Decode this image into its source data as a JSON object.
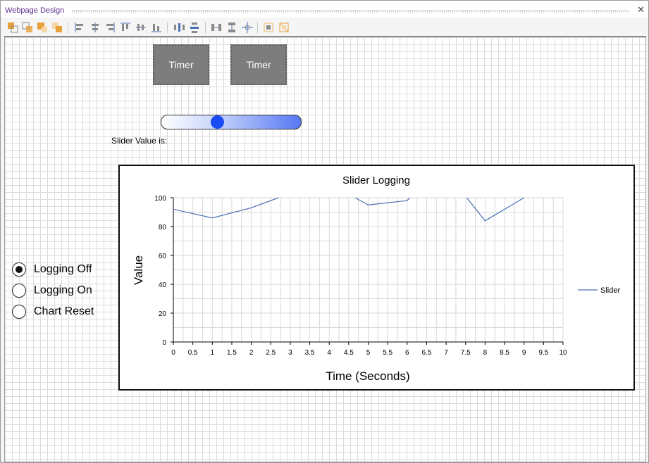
{
  "window": {
    "title": "Webpage Design",
    "close_glyph": "✕"
  },
  "toolbar": {
    "buttons": [
      {
        "icon": "bring-to-front-icon"
      },
      {
        "icon": "send-backward-icon"
      },
      {
        "icon": "bring-forward-icon"
      },
      {
        "icon": "send-to-back-icon"
      },
      {
        "icon": "align-left-icon"
      },
      {
        "icon": "align-center-icon"
      },
      {
        "icon": "align-right-icon"
      },
      {
        "icon": "align-top-icon"
      },
      {
        "icon": "align-middle-icon"
      },
      {
        "icon": "align-bottom-icon"
      },
      {
        "icon": "distribute-horizontal-icon"
      },
      {
        "icon": "distribute-vertical-icon"
      },
      {
        "icon": "space-horizontal-icon"
      },
      {
        "icon": "space-vertical-icon"
      },
      {
        "icon": "center-icon"
      },
      {
        "icon": "group-icon"
      },
      {
        "icon": "ungroup-icon"
      }
    ],
    "colors": {
      "orange": "#e8a038",
      "gray": "#8a8a8a",
      "blue": "#4a6fb5"
    }
  },
  "timers": [
    {
      "label": "Timer"
    },
    {
      "label": "Timer"
    }
  ],
  "slider": {
    "value_fraction": 0.4,
    "label": "Slider Value is:",
    "thumb_color": "#1a4cf5"
  },
  "radio_options": [
    {
      "label": "Logging Off",
      "checked": true
    },
    {
      "label": "Logging On",
      "checked": false
    },
    {
      "label": "Chart Reset",
      "checked": false
    }
  ],
  "chart_data": {
    "type": "line",
    "title": "Slider Logging",
    "xlabel": "Time (Seconds)",
    "ylabel": "Value",
    "xlim": [
      0,
      10
    ],
    "ylim": [
      0,
      100
    ],
    "x_ticks": [
      "0",
      "0.5",
      "1",
      "1.5",
      "2",
      "2.5",
      "3",
      "3.5",
      "4",
      "4.5",
      "5",
      "5.5",
      "6",
      "6.5",
      "7",
      "7.5",
      "8",
      "8.5",
      "9",
      "9.5",
      "10"
    ],
    "y_ticks": [
      "0",
      "20",
      "40",
      "60",
      "80",
      "100"
    ],
    "grid": true,
    "legend_position": "right",
    "series": [
      {
        "name": "Slider",
        "color": "#4a6fb5",
        "x": [
          0,
          1,
          2,
          2.8,
          4.6,
          5,
          6,
          6.1,
          7.5,
          8,
          9
        ],
        "y": [
          92,
          86,
          93,
          101,
          101,
          95,
          98,
          101,
          101,
          84,
          100
        ]
      }
    ]
  }
}
